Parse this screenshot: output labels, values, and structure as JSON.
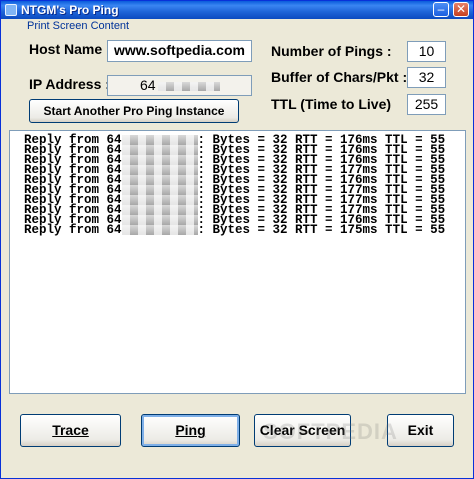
{
  "window": {
    "title": "NTGM's Pro Ping",
    "minimize_glyph": "–",
    "close_glyph": "✕"
  },
  "menu": {
    "print_screen": "Print Screen Content"
  },
  "form": {
    "host_name_label": "Host Name :",
    "host_name_value": "www.softpedia.com",
    "ip_address_label": "IP Address :",
    "ip_address_value": "64",
    "pings_label": "Number of Pings :",
    "pings_value": "10",
    "buffer_label": "Buffer of Chars/Pkt :",
    "buffer_value": "32",
    "ttl_label": "TTL (Time to Live)",
    "ttl_value": "255",
    "start_instance_label": "Start Another Pro Ping Instance"
  },
  "output": {
    "lines": [
      {
        "prefix": "Reply from 64",
        "suffix": ": Bytes = 32 RTT = 176ms TTL = 55"
      },
      {
        "prefix": "Reply from 64",
        "suffix": ": Bytes = 32 RTT = 176ms TTL = 55"
      },
      {
        "prefix": "Reply from 64",
        "suffix": ": Bytes = 32 RTT = 176ms TTL = 55"
      },
      {
        "prefix": "Reply from 64",
        "suffix": ": Bytes = 32 RTT = 177ms TTL = 55"
      },
      {
        "prefix": "Reply from 64",
        "suffix": ": Bytes = 32 RTT = 176ms TTL = 55"
      },
      {
        "prefix": "Reply from 64",
        "suffix": ": Bytes = 32 RTT = 177ms TTL = 55"
      },
      {
        "prefix": "Reply from 64",
        "suffix": ": Bytes = 32 RTT = 177ms TTL = 55"
      },
      {
        "prefix": "Reply from 64",
        "suffix": ": Bytes = 32 RTT = 177ms TTL = 55"
      },
      {
        "prefix": "Reply from 64",
        "suffix": ": Bytes = 32 RTT = 176ms TTL = 55"
      },
      {
        "prefix": "Reply from 64",
        "suffix": ": Bytes = 32 RTT = 175ms TTL = 55"
      }
    ]
  },
  "buttons": {
    "trace": "Trace",
    "ping": "Ping",
    "clear": "Clear Screen",
    "exit": "Exit"
  },
  "watermark": "SOFTPEDIA"
}
